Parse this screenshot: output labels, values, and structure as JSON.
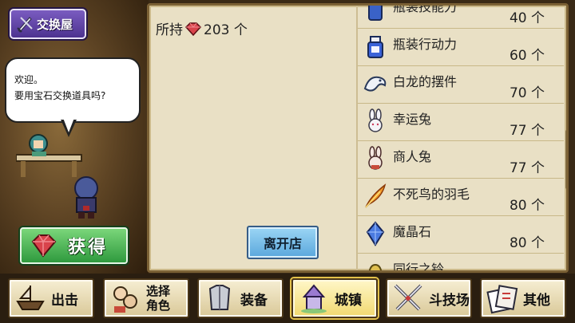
{
  "shop": {
    "name": "交换屋",
    "greeting_line1": "欢迎。",
    "greeting_line2": "要用宝石交换道具吗?",
    "get_label": "获得"
  },
  "panel": {
    "owned_prefix": "所持",
    "owned_count": "203 个",
    "leave_label": "离开店"
  },
  "items": [
    {
      "name": "瓶装技能力",
      "price": "40 个",
      "icon": "bottle-icon"
    },
    {
      "name": "瓶装行动力",
      "price": "60 个",
      "icon": "bottle-icon"
    },
    {
      "name": "白龙的摆件",
      "price": "70 个",
      "icon": "white-dragon-icon"
    },
    {
      "name": "幸运兔",
      "price": "77 个",
      "icon": "rabbit-icon"
    },
    {
      "name": "商人兔",
      "price": "77 个",
      "icon": "rabbit-icon"
    },
    {
      "name": "不死鸟的羽毛",
      "price": "80 个",
      "icon": "feather-icon"
    },
    {
      "name": "魔晶石",
      "price": "80 个",
      "icon": "crystal-icon"
    },
    {
      "name": "同行之铃",
      "price": "",
      "icon": "bell-icon"
    }
  ],
  "nav": {
    "sortie": "出击",
    "select_line1": "选择",
    "select_line2": "角色",
    "equip": "装备",
    "town": "城镇",
    "arena": "斗技场",
    "other": "其他"
  },
  "colors": {
    "gem": "#d8434b",
    "panel_bg": "#e9e0c5",
    "get_button": "#3aa548",
    "leave_button": "#6fb5e4",
    "active_nav": "#f1d970"
  }
}
